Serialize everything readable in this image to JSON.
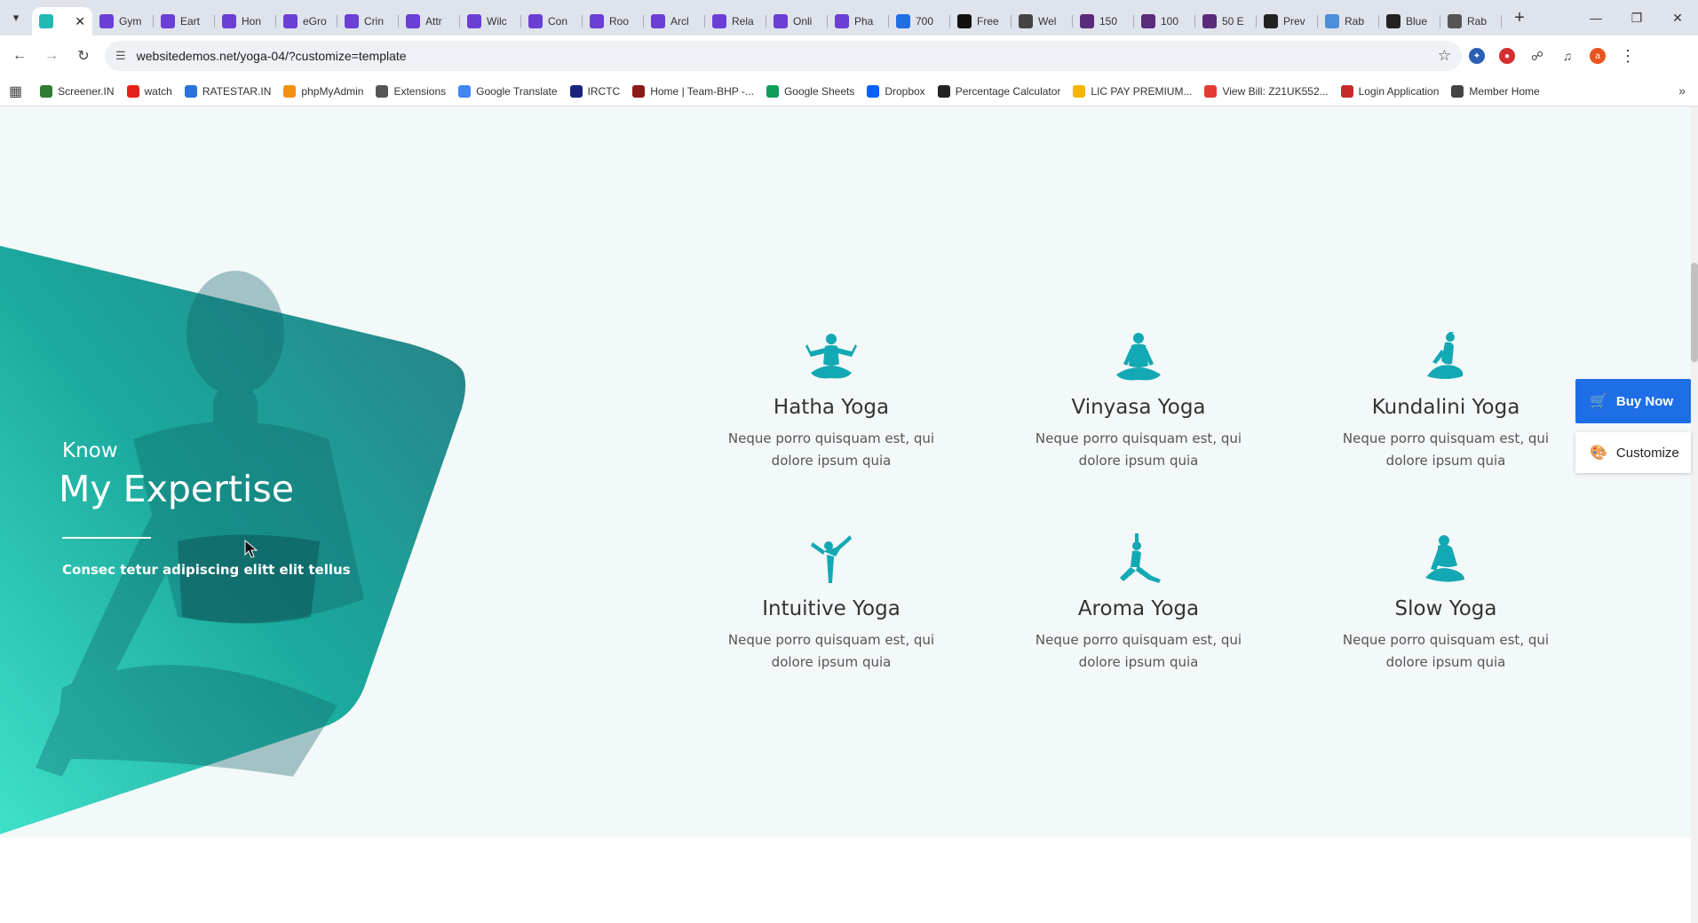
{
  "browser": {
    "tabs": [
      {
        "label": "",
        "active": true,
        "color": "#22b8b4"
      },
      {
        "label": "Gym",
        "color": "#6b3fd6"
      },
      {
        "label": "Eart",
        "color": "#6b3fd6"
      },
      {
        "label": "Hon",
        "color": "#6b3fd6"
      },
      {
        "label": "eGro",
        "color": "#6b3fd6"
      },
      {
        "label": "Crin",
        "color": "#6b3fd6"
      },
      {
        "label": "Attr",
        "color": "#6b3fd6"
      },
      {
        "label": "Wilc",
        "color": "#6b3fd6"
      },
      {
        "label": "Con",
        "color": "#6b3fd6"
      },
      {
        "label": "Roo",
        "color": "#6b3fd6"
      },
      {
        "label": "Arcl",
        "color": "#6b3fd6"
      },
      {
        "label": "Rela",
        "color": "#6b3fd6"
      },
      {
        "label": "Onli",
        "color": "#6b3fd6"
      },
      {
        "label": "Pha",
        "color": "#6b3fd6"
      },
      {
        "label": "700",
        "color": "#1f6fe0"
      },
      {
        "label": "Free",
        "color": "#111111"
      },
      {
        "label": "Wel",
        "color": "#444444"
      },
      {
        "label": "150",
        "color": "#5a2b7a"
      },
      {
        "label": "100",
        "color": "#5a2b7a"
      },
      {
        "label": "50 E",
        "color": "#5a2b7a"
      },
      {
        "label": "Prev",
        "color": "#222222"
      },
      {
        "label": "Rab",
        "color": "#4a8fd8"
      },
      {
        "label": "Blue",
        "color": "#222222"
      },
      {
        "label": "Rab",
        "color": "#555555"
      }
    ],
    "url": "websitedemos.net/yoga-04/?customize=template",
    "bookmarks": [
      {
        "label": "Screener.IN",
        "color": "#2e7d32"
      },
      {
        "label": "watch",
        "color": "#e62117"
      },
      {
        "label": "RATESTAR.IN",
        "color": "#2a74d8"
      },
      {
        "label": "phpMyAdmin",
        "color": "#f29111"
      },
      {
        "label": "Extensions",
        "color": "#555555"
      },
      {
        "label": "Google Translate",
        "color": "#4285f4"
      },
      {
        "label": "IRCTC",
        "color": "#1a237e"
      },
      {
        "label": "Home | Team-BHP -...",
        "color": "#8b1a1a"
      },
      {
        "label": "Google Sheets",
        "color": "#0f9d58"
      },
      {
        "label": "Dropbox",
        "color": "#0061ff"
      },
      {
        "label": "Percentage Calculator",
        "color": "#222222"
      },
      {
        "label": "LIC PAY PREMIUM...",
        "color": "#f5b400"
      },
      {
        "label": "View Bill: Z21UK552...",
        "color": "#e53935"
      },
      {
        "label": "Login Application",
        "color": "#c62828"
      },
      {
        "label": "Member Home",
        "color": "#444444"
      }
    ]
  },
  "hero": {
    "small": "Know",
    "big": "My Expertise",
    "sub": "Consec tetur adipiscing elitt elit tellus"
  },
  "services": [
    {
      "title": "Hatha Yoga",
      "desc_line1": "Neque porro quisquam est, qui",
      "desc_line2": "dolore ipsum quia",
      "icon": "meditation-arms-up-icon"
    },
    {
      "title": "Vinyasa Yoga",
      "desc_line1": "Neque porro quisquam est, qui",
      "desc_line2": "dolore ipsum quia",
      "icon": "lotus-pose-icon"
    },
    {
      "title": "Kundalini Yoga",
      "desc_line1": "Neque porro quisquam est, qui",
      "desc_line2": "dolore ipsum quia",
      "icon": "seated-twist-icon"
    },
    {
      "title": "Intuitive Yoga",
      "desc_line1": "Neque porro quisquam est, qui",
      "desc_line2": "dolore ipsum quia",
      "icon": "dancer-pose-icon"
    },
    {
      "title": "Aroma Yoga",
      "desc_line1": "Neque porro quisquam est, qui",
      "desc_line2": "dolore ipsum quia",
      "icon": "lunge-pose-icon"
    },
    {
      "title": "Slow Yoga",
      "desc_line1": "Neque porro quisquam est, qui",
      "desc_line2": "dolore ipsum quia",
      "icon": "seated-bend-icon"
    }
  ],
  "side": {
    "buy_label": "Buy Now",
    "customize_label": "Customize"
  },
  "colors": {
    "accent": "#13a9b4",
    "buy": "#1e6ee8",
    "section_bg": "#f3f8f9"
  }
}
